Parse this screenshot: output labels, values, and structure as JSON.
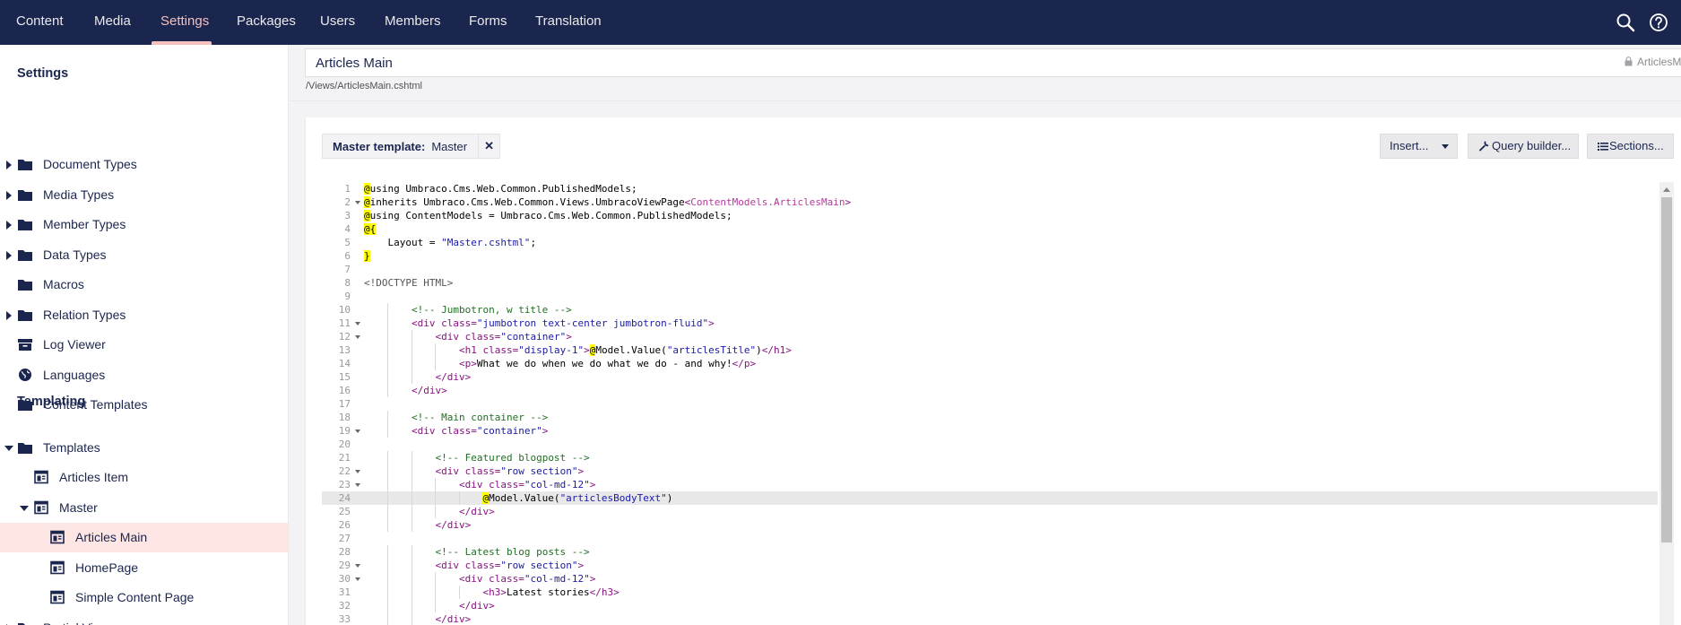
{
  "nav": {
    "items": [
      "Content",
      "Media",
      "Settings",
      "Packages",
      "Users",
      "Members",
      "Forms",
      "Translation"
    ],
    "active": "Settings",
    "search_icon": "search-icon",
    "help_icon": "help-icon"
  },
  "sidebar": {
    "settings_title": "Settings",
    "settings_items": [
      {
        "label": "Document Types",
        "icon": "folder-icon",
        "expandable": true
      },
      {
        "label": "Media Types",
        "icon": "folder-icon",
        "expandable": true
      },
      {
        "label": "Member Types",
        "icon": "folder-icon",
        "expandable": true
      },
      {
        "label": "Data Types",
        "icon": "folder-icon",
        "expandable": true
      },
      {
        "label": "Macros",
        "icon": "folder-icon",
        "expandable": false
      },
      {
        "label": "Relation Types",
        "icon": "folder-icon",
        "expandable": true
      },
      {
        "label": "Log Viewer",
        "icon": "archive-icon",
        "expandable": false
      },
      {
        "label": "Languages",
        "icon": "globe-icon",
        "expandable": false
      },
      {
        "label": "Content Templates",
        "icon": "folder-icon",
        "expandable": false
      }
    ],
    "templating_title": "Templating",
    "templates_folder": "Templates",
    "templates": [
      {
        "label": "Articles Item",
        "level": 1
      },
      {
        "label": "Master",
        "level": 1,
        "expanded": true
      },
      {
        "label": "Articles Main",
        "level": 2,
        "selected": true
      },
      {
        "label": "HomePage",
        "level": 2
      },
      {
        "label": "Simple Content Page",
        "level": 2
      },
      {
        "label": "Partial Views",
        "level": 0,
        "cut": true
      }
    ]
  },
  "editor": {
    "name": "Articles Main",
    "alias": "ArticlesMain",
    "path": "/Views/ArticlesMain.cshtml",
    "master_label": "Master template:",
    "master_value": "Master",
    "remove_symbol": "✕",
    "insert_label": "Insert...",
    "query_label": "Query builder...",
    "sections_label": "Sections...",
    "active_line": 24
  },
  "code": [
    [
      [
        "at",
        "@"
      ],
      [
        "",
        "using Umbraco.Cms.Web.Common.PublishedModels;"
      ]
    ],
    [
      [
        "at",
        "@"
      ],
      [
        "",
        "inherits Umbraco.Cms.Web.Common.Views.UmbracoViewPage"
      ],
      [
        "tag",
        "<"
      ],
      [
        "gen",
        "ContentModels.ArticlesMain"
      ],
      [
        "tag",
        ">"
      ]
    ],
    [
      [
        "at",
        "@"
      ],
      [
        "",
        "using ContentModels = Umbraco.Cms.Web.Common.PublishedModels;"
      ]
    ],
    [
      [
        "at",
        "@{"
      ]
    ],
    [
      [
        "",
        "    Layout = "
      ],
      [
        "str",
        "\"Master.cshtml\""
      ],
      [
        "",
        ";"
      ]
    ],
    [
      [
        "at",
        "}"
      ]
    ],
    [],
    [
      [
        "doc",
        "<!DOCTYPE HTML>"
      ]
    ],
    [],
    [
      [
        "",
        "        "
      ],
      [
        "cmt",
        "<!-- Jumbotron, w title -->"
      ]
    ],
    [
      [
        "",
        "        "
      ],
      [
        "tag",
        "<div "
      ],
      [
        "tag",
        "class="
      ],
      [
        "str",
        "\"jumbotron text-center jumbotron-fluid\""
      ],
      [
        "tag",
        ">"
      ]
    ],
    [
      [
        "",
        "            "
      ],
      [
        "tag",
        "<div "
      ],
      [
        "tag",
        "class="
      ],
      [
        "str",
        "\"container\""
      ],
      [
        "tag",
        ">"
      ]
    ],
    [
      [
        "",
        "                "
      ],
      [
        "tag",
        "<h1 "
      ],
      [
        "tag",
        "class="
      ],
      [
        "str",
        "\"display-1\""
      ],
      [
        "tag",
        ">"
      ],
      [
        "at",
        "@"
      ],
      [
        "",
        "Model.Value("
      ],
      [
        "str",
        "\"articlesTitle\""
      ],
      [
        "",
        ")"
      ],
      [
        "tag",
        "</h1>"
      ]
    ],
    [
      [
        "",
        "                "
      ],
      [
        "tag",
        "<p>"
      ],
      [
        "",
        "What we do when we do what we do - and why!"
      ],
      [
        "tag",
        "</p>"
      ]
    ],
    [
      [
        "",
        "            "
      ],
      [
        "tag",
        "</div>"
      ]
    ],
    [
      [
        "",
        "        "
      ],
      [
        "tag",
        "</div>"
      ]
    ],
    [],
    [
      [
        "",
        "        "
      ],
      [
        "cmt",
        "<!-- Main container -->"
      ]
    ],
    [
      [
        "",
        "        "
      ],
      [
        "tag",
        "<div "
      ],
      [
        "tag",
        "class="
      ],
      [
        "str",
        "\"container\""
      ],
      [
        "tag",
        ">"
      ]
    ],
    [],
    [
      [
        "",
        "            "
      ],
      [
        "cmt",
        "<!-- Featured blogpost -->"
      ]
    ],
    [
      [
        "",
        "            "
      ],
      [
        "tag",
        "<div "
      ],
      [
        "tag",
        "class="
      ],
      [
        "str",
        "\"row section\""
      ],
      [
        "tag",
        ">"
      ]
    ],
    [
      [
        "",
        "                "
      ],
      [
        "tag",
        "<div "
      ],
      [
        "tag",
        "class="
      ],
      [
        "str",
        "\"col-md-12\""
      ],
      [
        "tag",
        ">"
      ]
    ],
    [
      [
        "",
        "                    "
      ],
      [
        "at",
        "@"
      ],
      [
        "",
        "Model.Value("
      ],
      [
        "str",
        "\"articlesBodyText\""
      ],
      [
        "",
        ")"
      ]
    ],
    [
      [
        "",
        "                "
      ],
      [
        "tag",
        "</div>"
      ]
    ],
    [
      [
        "",
        "            "
      ],
      [
        "tag",
        "</div>"
      ]
    ],
    [],
    [
      [
        "",
        "            "
      ],
      [
        "cmt",
        "<!-- Latest blog posts -->"
      ]
    ],
    [
      [
        "",
        "            "
      ],
      [
        "tag",
        "<div "
      ],
      [
        "tag",
        "class="
      ],
      [
        "str",
        "\"row section\""
      ],
      [
        "tag",
        ">"
      ]
    ],
    [
      [
        "",
        "                "
      ],
      [
        "tag",
        "<div "
      ],
      [
        "tag",
        "class="
      ],
      [
        "str",
        "\"col-md-12\""
      ],
      [
        "tag",
        ">"
      ]
    ],
    [
      [
        "",
        "                    "
      ],
      [
        "tag",
        "<h3>"
      ],
      [
        "",
        "Latest stories"
      ],
      [
        "tag",
        "</h3>"
      ]
    ],
    [
      [
        "",
        "                "
      ],
      [
        "tag",
        "</div>"
      ]
    ],
    [
      [
        "",
        "            "
      ],
      [
        "tag",
        "</div>"
      ]
    ]
  ],
  "fold_lines": [
    2,
    11,
    12,
    19,
    22,
    23,
    29,
    30
  ],
  "colors": {
    "nav_bg": "#1b264f",
    "nav_active": "#f5c1bc",
    "selected_bg": "#fde6e4"
  }
}
